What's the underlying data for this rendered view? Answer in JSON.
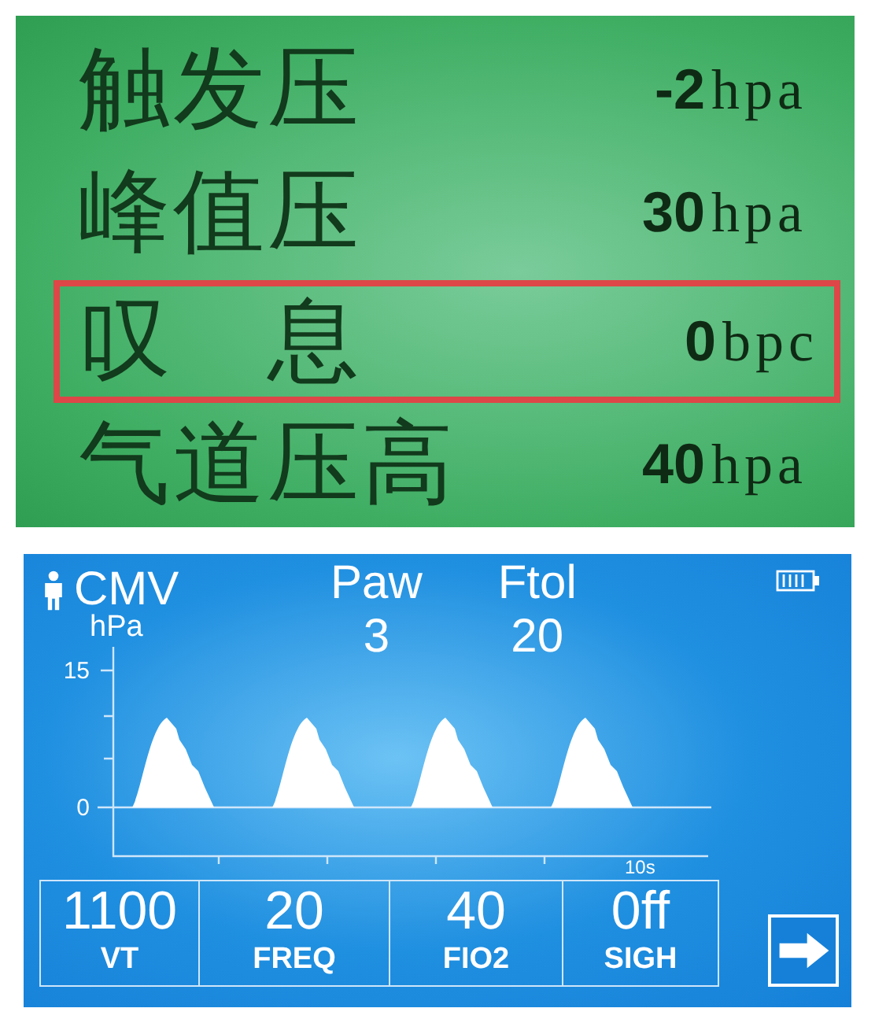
{
  "settings_screen": {
    "rows": [
      {
        "label": "触发压",
        "value": "-2",
        "unit": "hpa",
        "highlighted": false
      },
      {
        "label": "峰值压",
        "value": "30",
        "unit": "hpa",
        "highlighted": false
      },
      {
        "label": "叹　息",
        "value": "0",
        "unit": "bpc",
        "highlighted": true
      },
      {
        "label": "气道压高",
        "value": "40",
        "unit": "hpa",
        "highlighted": false
      }
    ]
  },
  "ventilator_screen": {
    "mode": "CMV",
    "unit": "hPa",
    "readings": [
      {
        "label": "Paw",
        "value": "3"
      },
      {
        "label": "Ftol",
        "value": "20"
      }
    ],
    "chart": {
      "y_labels": [
        "15",
        "0"
      ],
      "x_label": "10s"
    },
    "parameters": [
      {
        "value": "1100",
        "label": "VT"
      },
      {
        "value": "20",
        "label": "FREQ"
      },
      {
        "value": "40",
        "label": "FIO2"
      },
      {
        "value": "0ff",
        "label": "SIGH"
      }
    ]
  }
}
